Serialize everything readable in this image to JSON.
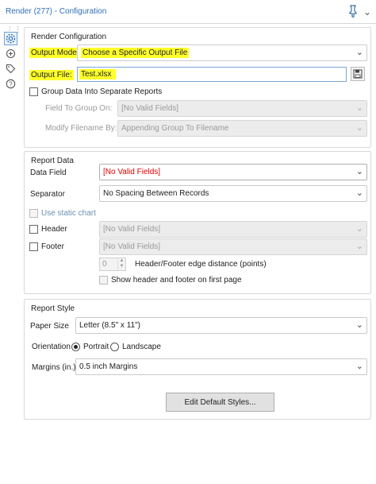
{
  "titlebar": {
    "title": "Render (277) - Configuration"
  },
  "render_config": {
    "group_title": "Render Configuration",
    "output_mode_label": "Output Mode:",
    "output_mode_value": "Choose a Specific Output File",
    "output_file_label": "Output File:",
    "output_file_value": "Test.xlsx",
    "group_data_label": "Group Data Into Separate Reports",
    "field_to_group_label": "Field To Group On:",
    "field_to_group_value": "[No Valid Fields]",
    "modify_filename_label": "Modify Filename By:",
    "modify_filename_value": "Appending Group To Filename"
  },
  "report_data": {
    "group_title": "Report Data",
    "data_field_label": "Data Field",
    "data_field_value": "[No Valid Fields]",
    "separator_label": "Separator",
    "separator_value": "No Spacing Between Records",
    "static_chart_label": "Use static chart",
    "header_label": "Header",
    "header_value": "[No Valid Fields]",
    "footer_label": "Footer",
    "footer_value": "[No Valid Fields]",
    "edge_distance_value": "0",
    "edge_distance_label": "Header/Footer edge distance (points)",
    "show_first_page_label": "Show header and footer on first page"
  },
  "report_style": {
    "group_title": "Report Style",
    "paper_size_label": "Paper Size",
    "paper_size_value": "Letter (8.5\" x 11\")",
    "orientation_label": "Orientation",
    "portrait_label": "Portrait",
    "landscape_label": "Landscape",
    "margins_label": "Margins (in.)",
    "margins_value": "0.5 inch Margins",
    "edit_styles_label": "Edit Default Styles..."
  },
  "colors": {
    "highlight": "#ffff2a",
    "title_blue": "#2f6fb6",
    "error_red": "#e00000"
  }
}
